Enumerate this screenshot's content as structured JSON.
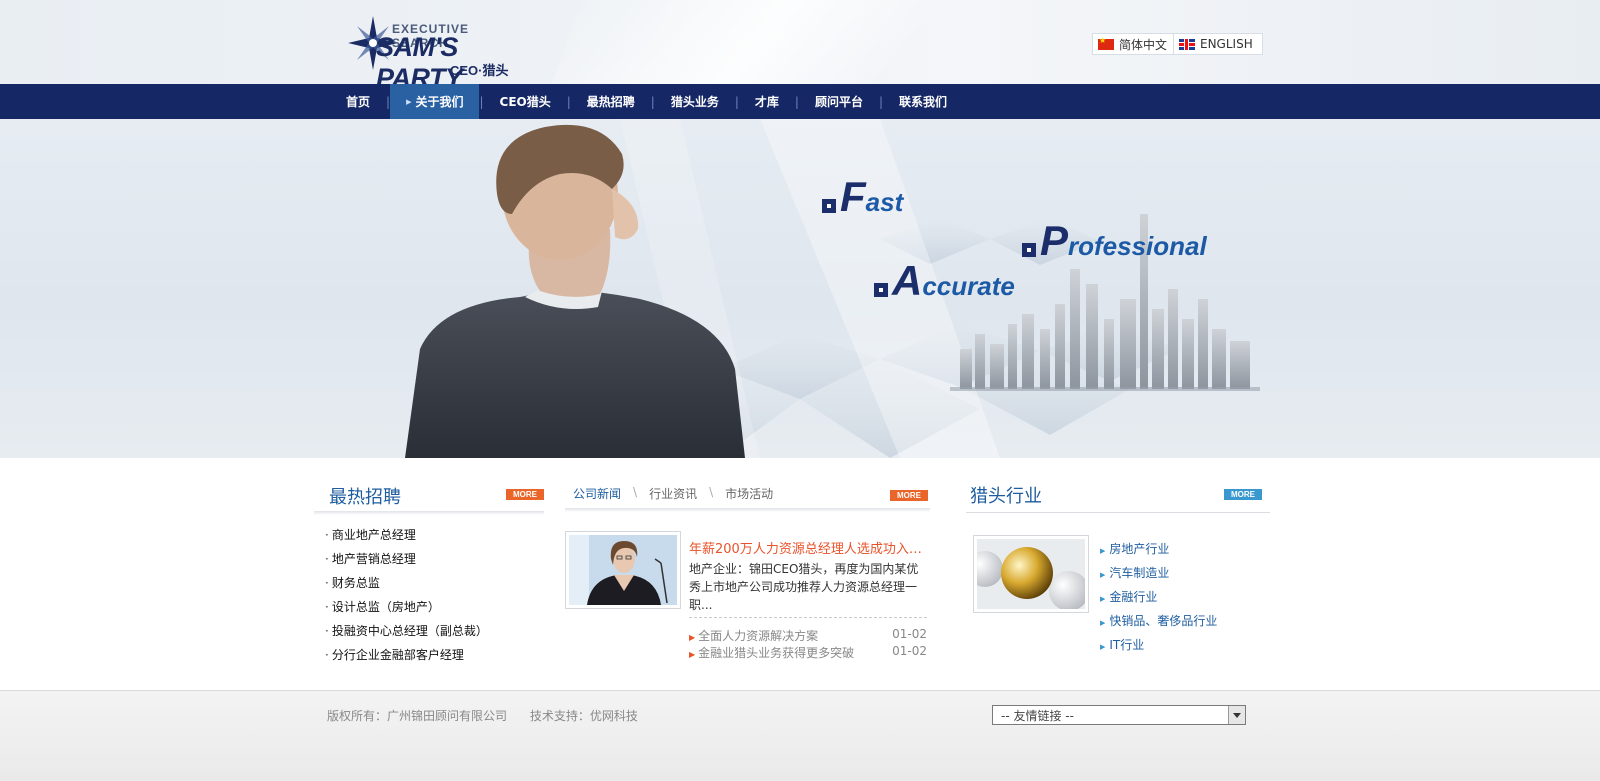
{
  "header": {
    "logo": {
      "executive_search": "EXECUTIVE SEARCH",
      "brand": "SAM'S PARTY",
      "subtitle": "CEO·猎头"
    },
    "languages": [
      {
        "label": "简体中文",
        "flag": "china-flag-icon"
      },
      {
        "label": "ENGLISH",
        "flag": "uk-flag-icon"
      }
    ]
  },
  "nav": {
    "items": [
      {
        "label": "首页"
      },
      {
        "label": "关于我们",
        "active": true
      },
      {
        "label": "CEO猎头"
      },
      {
        "label": "最热招聘"
      },
      {
        "label": "猎头业务"
      },
      {
        "label": "才库"
      },
      {
        "label": "顾问平台"
      },
      {
        "label": "联系我们"
      }
    ],
    "separator": "|"
  },
  "banner": {
    "taglines": [
      {
        "initial": "F",
        "rest": "ast"
      },
      {
        "initial": "P",
        "rest": "rofessional"
      },
      {
        "initial": "A",
        "rest": "ccurate"
      }
    ]
  },
  "hot_jobs": {
    "title": "最热招聘",
    "more": "MORE",
    "bullet": "·",
    "items": [
      "商业地产总经理",
      "地产营销总经理",
      "财务总监",
      "设计总监（房地产）",
      "投融资中心总经理（副总裁）",
      "分行企业金融部客户经理"
    ]
  },
  "news": {
    "tabs": [
      "公司新闻",
      "行业资讯",
      "市场活动"
    ],
    "tab_divider": "\\",
    "more": "MORE",
    "headline": "年薪200万人力资源总经理人选成功入主...",
    "summary": "地产企业：锦田CEO猎头，再度为国内某优秀上市地产公司成功推荐人力资源总经理一职...",
    "list": [
      {
        "title": "全面人力资源解决方案",
        "date": "01-02"
      },
      {
        "title": "金融业猎头业务获得更多突破",
        "date": "01-02"
      }
    ]
  },
  "industry": {
    "title": "猎头行业",
    "more": "MORE",
    "items": [
      "房地产行业",
      "汽车制造业",
      "金融行业",
      "快销品、奢侈品行业",
      "IT行业"
    ]
  },
  "footer": {
    "copyright": "版权所有：广州锦田顾问有限公司",
    "support": "技术支持：优网科技",
    "friend_links": "-- 友情链接 --"
  },
  "colors": {
    "nav_bg": "#152765",
    "nav_active": "#2961a3",
    "title_blue": "#1e5d9f",
    "accent_orange": "#e9532a"
  }
}
